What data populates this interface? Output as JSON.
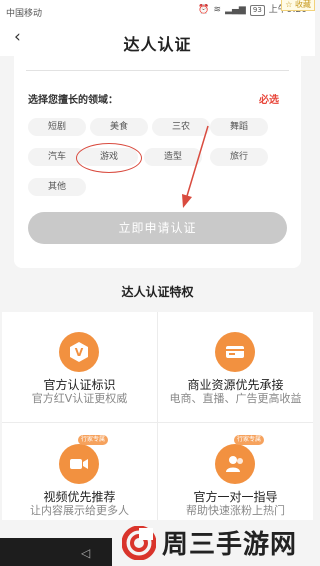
{
  "status": {
    "carrier": "中国移动",
    "battery": "93",
    "time": "上午9:20",
    "corner": "收藏"
  },
  "nav": {
    "title": "达人认证"
  },
  "form": {
    "label": "选择您擅长的领域：",
    "required": "必选",
    "tags": [
      "短剧",
      "美食",
      "三农",
      "舞蹈",
      "汽车",
      "游戏",
      "造型",
      "旅行",
      "其他"
    ],
    "selected": "游戏",
    "button": "立即申请认证"
  },
  "section": {
    "title": "达人认证特权"
  },
  "features": [
    {
      "title": "官方认证标识",
      "desc": "官方红V认证更权威",
      "icon": "v-badge-icon",
      "badge": ""
    },
    {
      "title": "商业资源优先承接",
      "desc": "电商、直播、广告更高收益",
      "icon": "card-icon",
      "badge": ""
    },
    {
      "title": "视频优先推荐",
      "desc": "让内容展示给更多人",
      "icon": "video-icon",
      "badge": "行家专属"
    },
    {
      "title": "官方一对一指导",
      "desc": "帮助快速涨粉上热门",
      "icon": "users-icon",
      "badge": "行家专属"
    }
  ],
  "watermark": {
    "text": "周三手游网"
  },
  "colors": {
    "accent": "#f29140",
    "required": "#e8463a",
    "button_disabled": "#c9c9c9"
  }
}
